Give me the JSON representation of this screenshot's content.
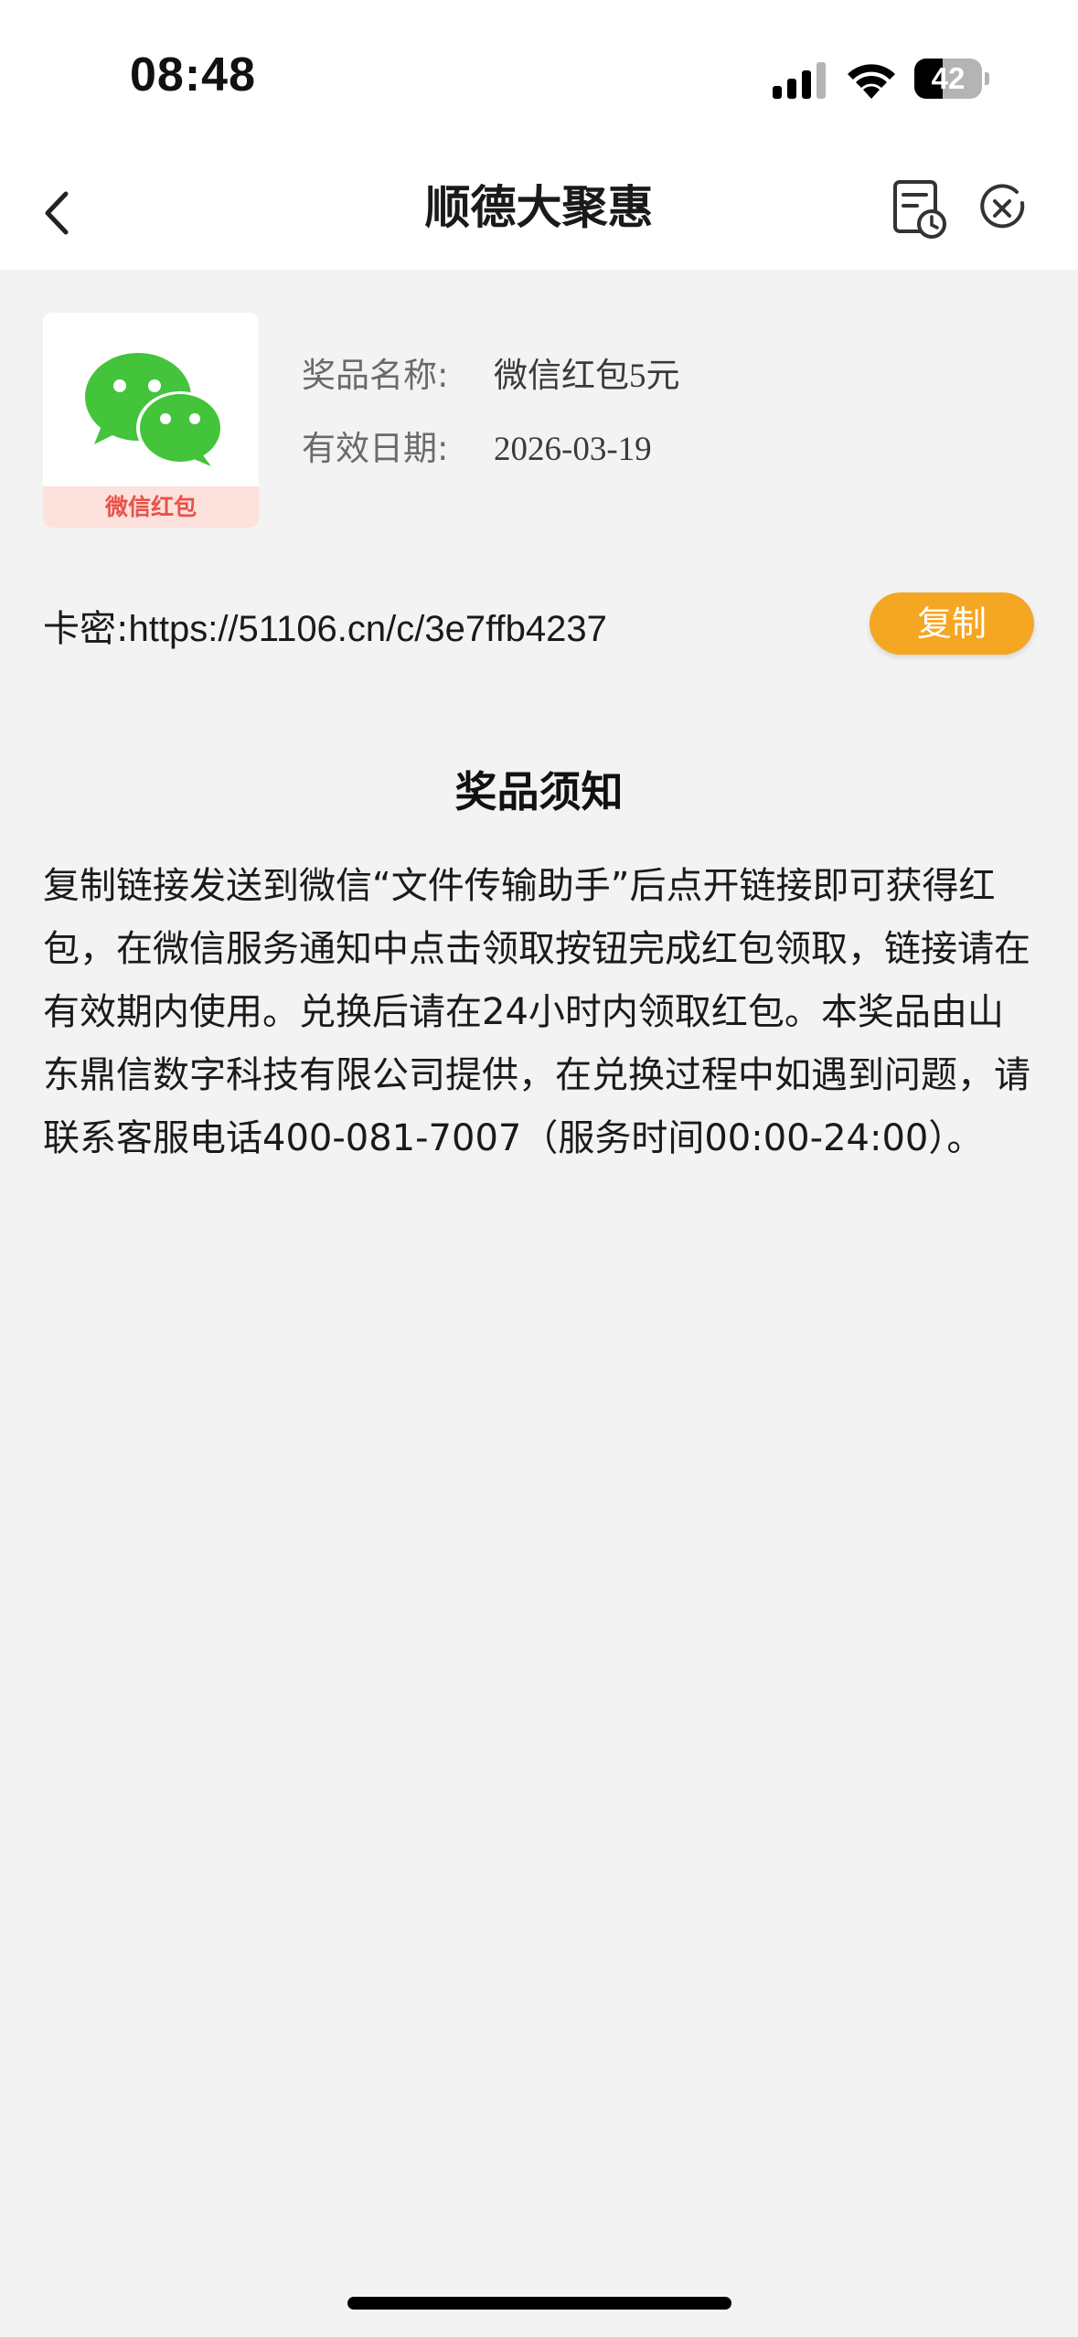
{
  "status_bar": {
    "time": "08:48",
    "battery_level": "42",
    "battery_fraction": 0.42,
    "icons": [
      "signal-icon",
      "wifi-icon",
      "battery-icon"
    ]
  },
  "nav": {
    "title": "顺德大聚惠",
    "icons": [
      "chevron-left-icon",
      "order-history-icon",
      "close-circle-icon"
    ]
  },
  "prize": {
    "card_label": "微信红包",
    "logo_icon": "wechat-logo-icon",
    "name_label": "奖品名称:",
    "name_value": "微信红包5元",
    "date_label": "有效日期:",
    "date_value": "2026-03-19"
  },
  "card_secret": {
    "label": "卡密:",
    "value": "https://51106.cn/c/3e7ffb4237",
    "copy_label": "复制"
  },
  "notice": {
    "title": "奖品须知",
    "body": "复制链接发送到微信“文件传输助手”后点开链接即可获得红包，在微信服务通知中点击领取按钮完成红包领取，链接请在有效期内使用。兑换后请在24小时内领取红包。本奖品由山东鼎信数字科技有限公司提供，在兑换过程中如遇到问题，请联系客服电话400-081-7007（服务时间00:00-24:00）。"
  },
  "colors": {
    "accent": "#f5a623",
    "background": "#f3f3f3",
    "wechat_green": "#43c43a",
    "card_label_bg": "#fde1dc",
    "card_label_text": "#e8524a"
  }
}
